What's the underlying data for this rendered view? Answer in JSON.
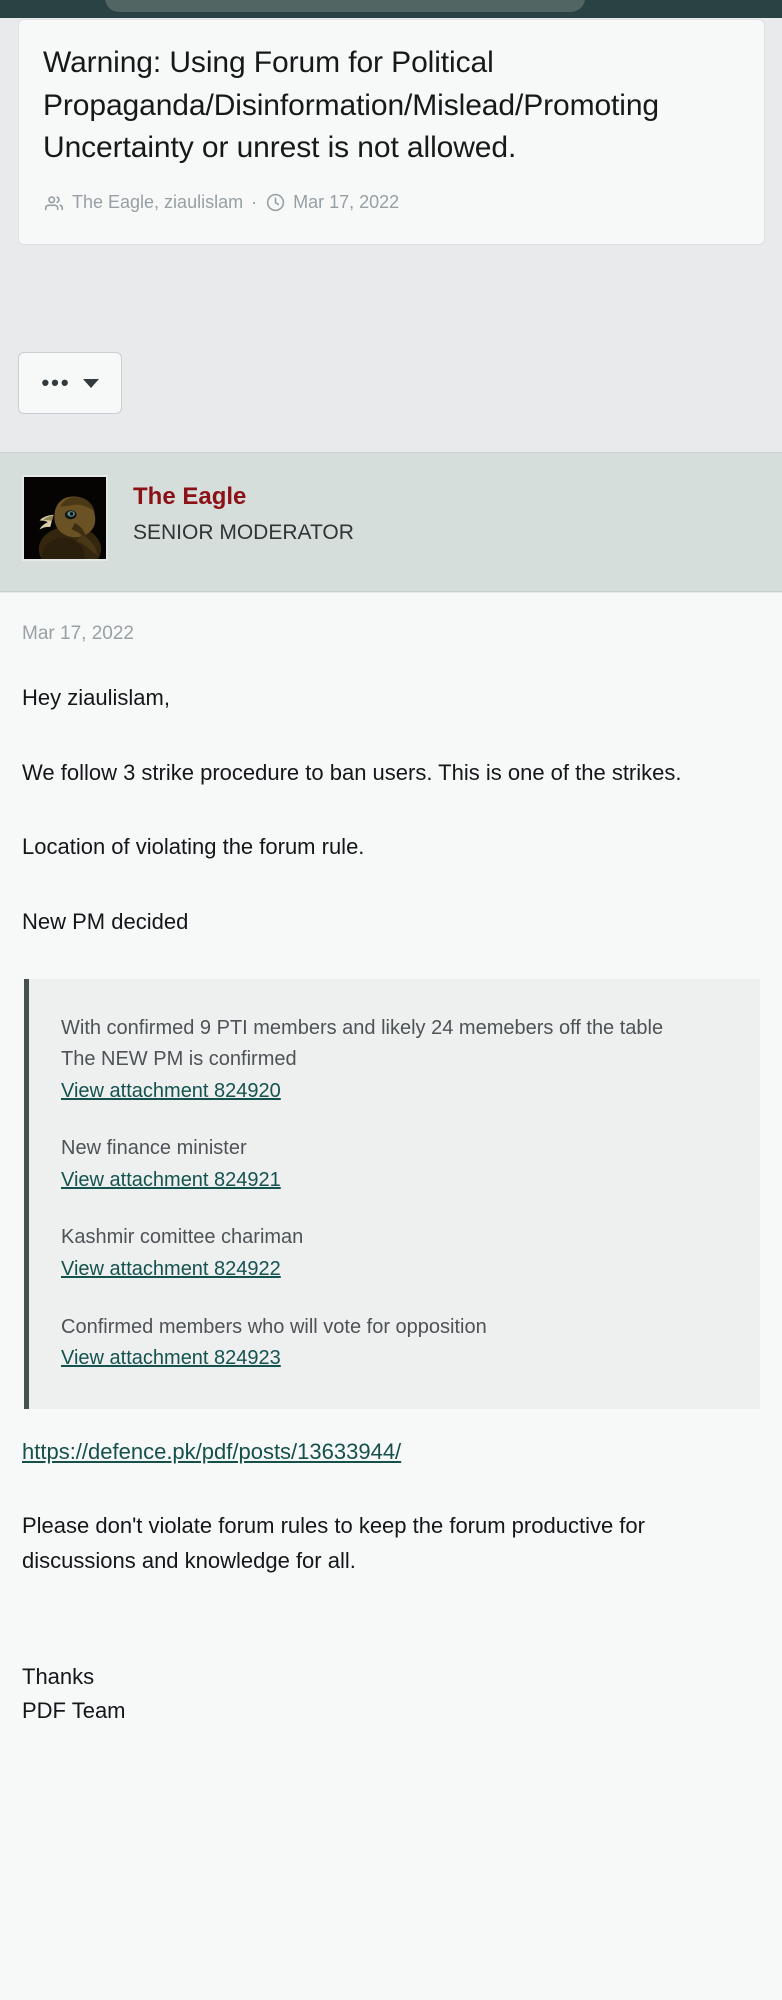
{
  "topbar": {
    "pill_label": ""
  },
  "warning_card": {
    "title": "Warning: Using Forum for Political Propaganda/Disinformation/Mislead/Promoting Uncertainty or unrest is not allowed.",
    "participants_icon": "users-icon",
    "participants": "The Eagle, ziaulislam",
    "separator": "·",
    "time_icon": "clock-icon",
    "date": "Mar 17, 2022"
  },
  "action_bar": {
    "more_button_label": "•••",
    "more_icon": "ellipsis-icon",
    "caret_icon": "caret-down-icon"
  },
  "author": {
    "avatar_icon": "eagle-avatar",
    "name": "The Eagle",
    "title": "SENIOR MODERATOR",
    "name_color": "#8b1117"
  },
  "message": {
    "date": "Mar 17, 2022",
    "greeting": "Hey ziaulislam,",
    "paragraph_1": "We follow 3 strike procedure to ban users. This is one of the strikes.",
    "paragraph_2": "Location of violating the forum rule.",
    "paragraph_3": "New PM decided",
    "quote": {
      "blocks": [
        {
          "lines": [
            "With confirmed 9 PTI members and likely 24 memebers off the table",
            "The NEW PM is confirmed"
          ],
          "link": "View attachment 824920"
        },
        {
          "lines": [
            "New finance minister"
          ],
          "link": "View attachment 824921"
        },
        {
          "lines": [
            "Kashmir comittee chariman"
          ],
          "link": "View attachment 824922"
        },
        {
          "lines": [
            "Confirmed members who will vote for opposition"
          ],
          "link": "View attachment 824923"
        }
      ]
    },
    "source_link": "https://defence.pk/pdf/posts/13633944/",
    "closing": "Please don't violate forum rules to keep the forum productive for discussions and knowledge for all.",
    "sign_off_1": "Thanks",
    "sign_off_2": "PDF Team"
  },
  "colors": {
    "header_bar": "#2b4244",
    "page_bg": "#e8eaec",
    "card_bg": "#f7f8f8",
    "user_strip_bg": "#d6dedb",
    "link": "#14524f",
    "quote_border": "#45504f"
  }
}
